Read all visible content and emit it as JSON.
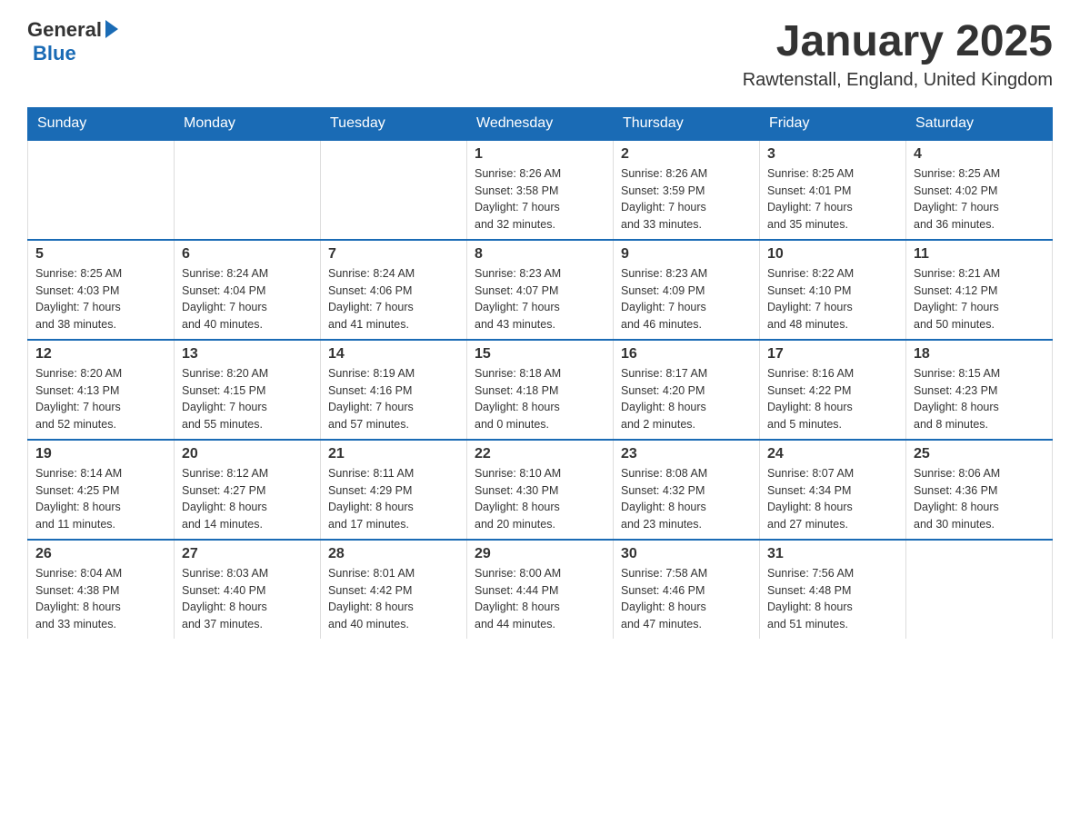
{
  "logo": {
    "general": "General",
    "blue": "Blue"
  },
  "header": {
    "title": "January 2025",
    "subtitle": "Rawtenstall, England, United Kingdom"
  },
  "days_of_week": [
    "Sunday",
    "Monday",
    "Tuesday",
    "Wednesday",
    "Thursday",
    "Friday",
    "Saturday"
  ],
  "weeks": [
    [
      {
        "day": "",
        "info": ""
      },
      {
        "day": "",
        "info": ""
      },
      {
        "day": "",
        "info": ""
      },
      {
        "day": "1",
        "info": "Sunrise: 8:26 AM\nSunset: 3:58 PM\nDaylight: 7 hours\nand 32 minutes."
      },
      {
        "day": "2",
        "info": "Sunrise: 8:26 AM\nSunset: 3:59 PM\nDaylight: 7 hours\nand 33 minutes."
      },
      {
        "day": "3",
        "info": "Sunrise: 8:25 AM\nSunset: 4:01 PM\nDaylight: 7 hours\nand 35 minutes."
      },
      {
        "day": "4",
        "info": "Sunrise: 8:25 AM\nSunset: 4:02 PM\nDaylight: 7 hours\nand 36 minutes."
      }
    ],
    [
      {
        "day": "5",
        "info": "Sunrise: 8:25 AM\nSunset: 4:03 PM\nDaylight: 7 hours\nand 38 minutes."
      },
      {
        "day": "6",
        "info": "Sunrise: 8:24 AM\nSunset: 4:04 PM\nDaylight: 7 hours\nand 40 minutes."
      },
      {
        "day": "7",
        "info": "Sunrise: 8:24 AM\nSunset: 4:06 PM\nDaylight: 7 hours\nand 41 minutes."
      },
      {
        "day": "8",
        "info": "Sunrise: 8:23 AM\nSunset: 4:07 PM\nDaylight: 7 hours\nand 43 minutes."
      },
      {
        "day": "9",
        "info": "Sunrise: 8:23 AM\nSunset: 4:09 PM\nDaylight: 7 hours\nand 46 minutes."
      },
      {
        "day": "10",
        "info": "Sunrise: 8:22 AM\nSunset: 4:10 PM\nDaylight: 7 hours\nand 48 minutes."
      },
      {
        "day": "11",
        "info": "Sunrise: 8:21 AM\nSunset: 4:12 PM\nDaylight: 7 hours\nand 50 minutes."
      }
    ],
    [
      {
        "day": "12",
        "info": "Sunrise: 8:20 AM\nSunset: 4:13 PM\nDaylight: 7 hours\nand 52 minutes."
      },
      {
        "day": "13",
        "info": "Sunrise: 8:20 AM\nSunset: 4:15 PM\nDaylight: 7 hours\nand 55 minutes."
      },
      {
        "day": "14",
        "info": "Sunrise: 8:19 AM\nSunset: 4:16 PM\nDaylight: 7 hours\nand 57 minutes."
      },
      {
        "day": "15",
        "info": "Sunrise: 8:18 AM\nSunset: 4:18 PM\nDaylight: 8 hours\nand 0 minutes."
      },
      {
        "day": "16",
        "info": "Sunrise: 8:17 AM\nSunset: 4:20 PM\nDaylight: 8 hours\nand 2 minutes."
      },
      {
        "day": "17",
        "info": "Sunrise: 8:16 AM\nSunset: 4:22 PM\nDaylight: 8 hours\nand 5 minutes."
      },
      {
        "day": "18",
        "info": "Sunrise: 8:15 AM\nSunset: 4:23 PM\nDaylight: 8 hours\nand 8 minutes."
      }
    ],
    [
      {
        "day": "19",
        "info": "Sunrise: 8:14 AM\nSunset: 4:25 PM\nDaylight: 8 hours\nand 11 minutes."
      },
      {
        "day": "20",
        "info": "Sunrise: 8:12 AM\nSunset: 4:27 PM\nDaylight: 8 hours\nand 14 minutes."
      },
      {
        "day": "21",
        "info": "Sunrise: 8:11 AM\nSunset: 4:29 PM\nDaylight: 8 hours\nand 17 minutes."
      },
      {
        "day": "22",
        "info": "Sunrise: 8:10 AM\nSunset: 4:30 PM\nDaylight: 8 hours\nand 20 minutes."
      },
      {
        "day": "23",
        "info": "Sunrise: 8:08 AM\nSunset: 4:32 PM\nDaylight: 8 hours\nand 23 minutes."
      },
      {
        "day": "24",
        "info": "Sunrise: 8:07 AM\nSunset: 4:34 PM\nDaylight: 8 hours\nand 27 minutes."
      },
      {
        "day": "25",
        "info": "Sunrise: 8:06 AM\nSunset: 4:36 PM\nDaylight: 8 hours\nand 30 minutes."
      }
    ],
    [
      {
        "day": "26",
        "info": "Sunrise: 8:04 AM\nSunset: 4:38 PM\nDaylight: 8 hours\nand 33 minutes."
      },
      {
        "day": "27",
        "info": "Sunrise: 8:03 AM\nSunset: 4:40 PM\nDaylight: 8 hours\nand 37 minutes."
      },
      {
        "day": "28",
        "info": "Sunrise: 8:01 AM\nSunset: 4:42 PM\nDaylight: 8 hours\nand 40 minutes."
      },
      {
        "day": "29",
        "info": "Sunrise: 8:00 AM\nSunset: 4:44 PM\nDaylight: 8 hours\nand 44 minutes."
      },
      {
        "day": "30",
        "info": "Sunrise: 7:58 AM\nSunset: 4:46 PM\nDaylight: 8 hours\nand 47 minutes."
      },
      {
        "day": "31",
        "info": "Sunrise: 7:56 AM\nSunset: 4:48 PM\nDaylight: 8 hours\nand 51 minutes."
      },
      {
        "day": "",
        "info": ""
      }
    ]
  ]
}
